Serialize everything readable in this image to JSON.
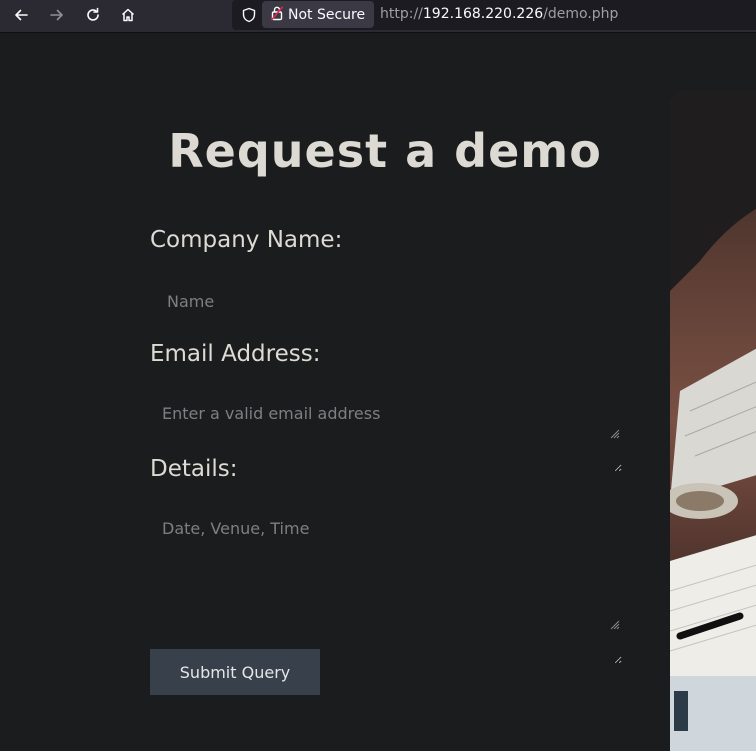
{
  "browser": {
    "security_label": "Not Secure",
    "url_scheme": "http://",
    "url_host": "192.168.220.226",
    "url_path": "/demo.php",
    "icons": [
      "back-arrow-icon",
      "forward-arrow-icon",
      "reload-icon",
      "home-icon",
      "shield-icon",
      "insecure-lock-icon"
    ]
  },
  "page": {
    "title": "Request a demo",
    "company_label": "Company Name:",
    "company_placeholder": "Name",
    "email_label": "Email Address:",
    "email_placeholder": "Enter a valid email address",
    "details_label": "Details:",
    "details_placeholder": "Date, Venue, Time",
    "submit_label": "Submit Query"
  },
  "colors": {
    "background": "#1b1c1e",
    "title_text": "#ddd9d3",
    "button_bg": "#38404c"
  }
}
